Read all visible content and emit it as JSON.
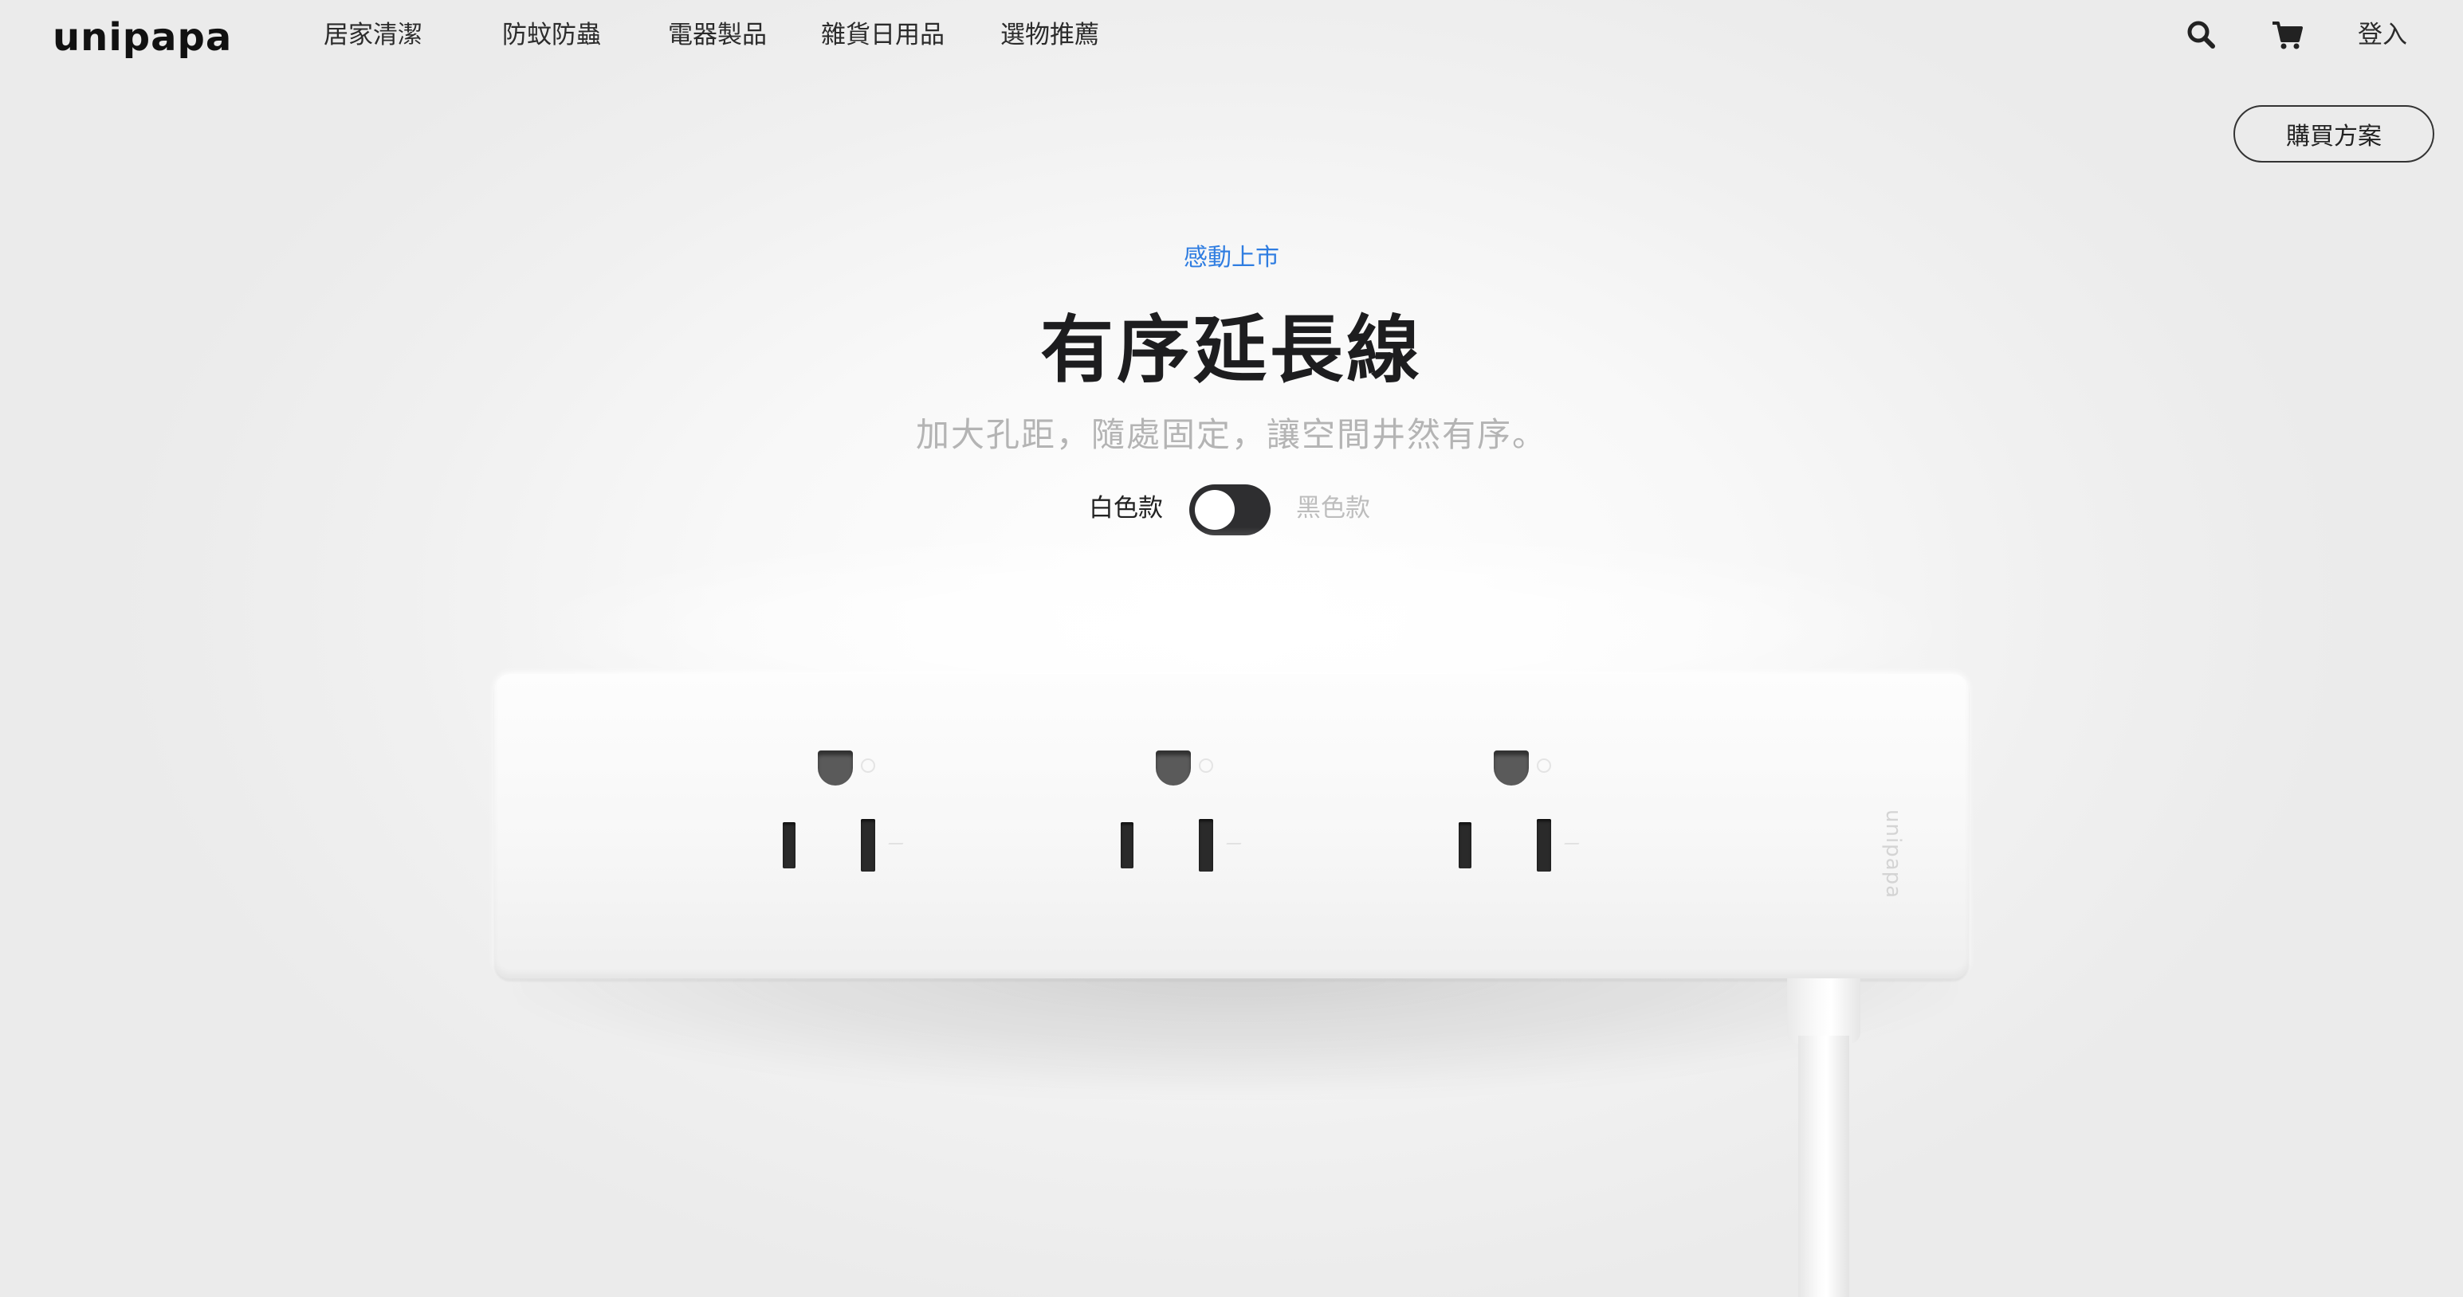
{
  "brand": {
    "logo_text": "unipapa"
  },
  "nav": {
    "items": [
      {
        "label": "居家清潔"
      },
      {
        "label": "防蚊防蟲"
      },
      {
        "label": "電器製品"
      },
      {
        "label": "雜貨日用品"
      },
      {
        "label": "選物推薦"
      }
    ]
  },
  "header_actions": {
    "search_icon": "search-icon",
    "cart_icon": "cart-icon",
    "login_label": "登入"
  },
  "buy_button": {
    "label": "購買方案"
  },
  "hero": {
    "eyebrow": "感動上市",
    "title": "有序延長線",
    "subtitle": "加大孔距，隨處固定，讓空間井然有序。",
    "eyebrow_color": "#2f7de1"
  },
  "color_switch": {
    "option_white": "白色款",
    "option_black": "黑色款",
    "selected": "白色款",
    "toggle_color": "#2e2e30"
  },
  "product": {
    "imprint": "unipapa",
    "outlet_count": 3
  }
}
